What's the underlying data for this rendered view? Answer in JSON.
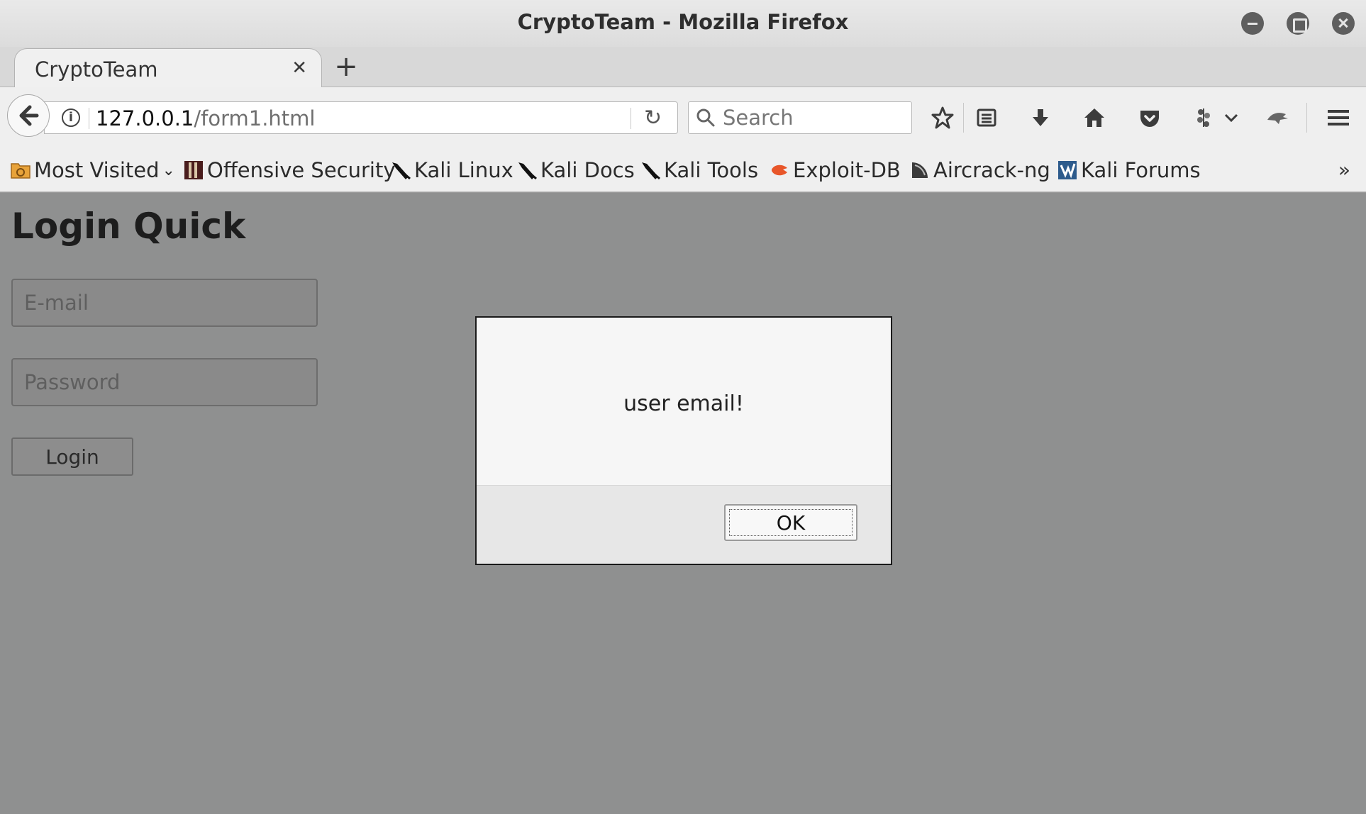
{
  "window": {
    "title": "CryptoTeam - Mozilla Firefox",
    "controls": [
      "minimize",
      "maximize",
      "close"
    ]
  },
  "tabs": [
    {
      "label": "CryptoTeam",
      "active": true
    }
  ],
  "navbar": {
    "url_host": "127.0.0.1",
    "url_path": "/form1.html",
    "search_placeholder": "Search",
    "icons": [
      "back-icon",
      "info-icon",
      "reload-icon",
      "search-icon",
      "bookmark-star-icon",
      "reading-list-icon",
      "download-icon",
      "home-icon",
      "pocket-icon",
      "extension-icon",
      "dropdown-icon",
      "kali-icon",
      "menu-icon"
    ]
  },
  "bookmarks": {
    "items": [
      {
        "label": "Most Visited",
        "icon": "folder-icon",
        "color": "#e8a33a"
      },
      {
        "label": "Offensive Security",
        "icon": "offsec-icon",
        "color": "#4a1d1d"
      },
      {
        "label": "Kali Linux",
        "icon": "kali-dragon-icon",
        "color": "#111111"
      },
      {
        "label": "Kali Docs",
        "icon": "kali-dragon-icon",
        "color": "#111111"
      },
      {
        "label": "Kali Tools",
        "icon": "kali-dragon-icon",
        "color": "#111111"
      },
      {
        "label": "Exploit-DB",
        "icon": "exploitdb-icon",
        "color": "#e8562a"
      },
      {
        "label": "Aircrack-ng",
        "icon": "aircrack-icon",
        "color": "#3b3b3b"
      },
      {
        "label": "Kali Forums",
        "icon": "kali-forums-icon",
        "color": "#2d5b8c"
      }
    ],
    "overflow_glyph": "»"
  },
  "page": {
    "title": "Login Quick",
    "email_placeholder": "E-mail",
    "password_placeholder": "Password",
    "login_label": "Login"
  },
  "dialog": {
    "message": "user email!",
    "ok_label": "OK"
  },
  "colors": {
    "page_background": "#8f9090",
    "chrome_background": "#efefef"
  }
}
